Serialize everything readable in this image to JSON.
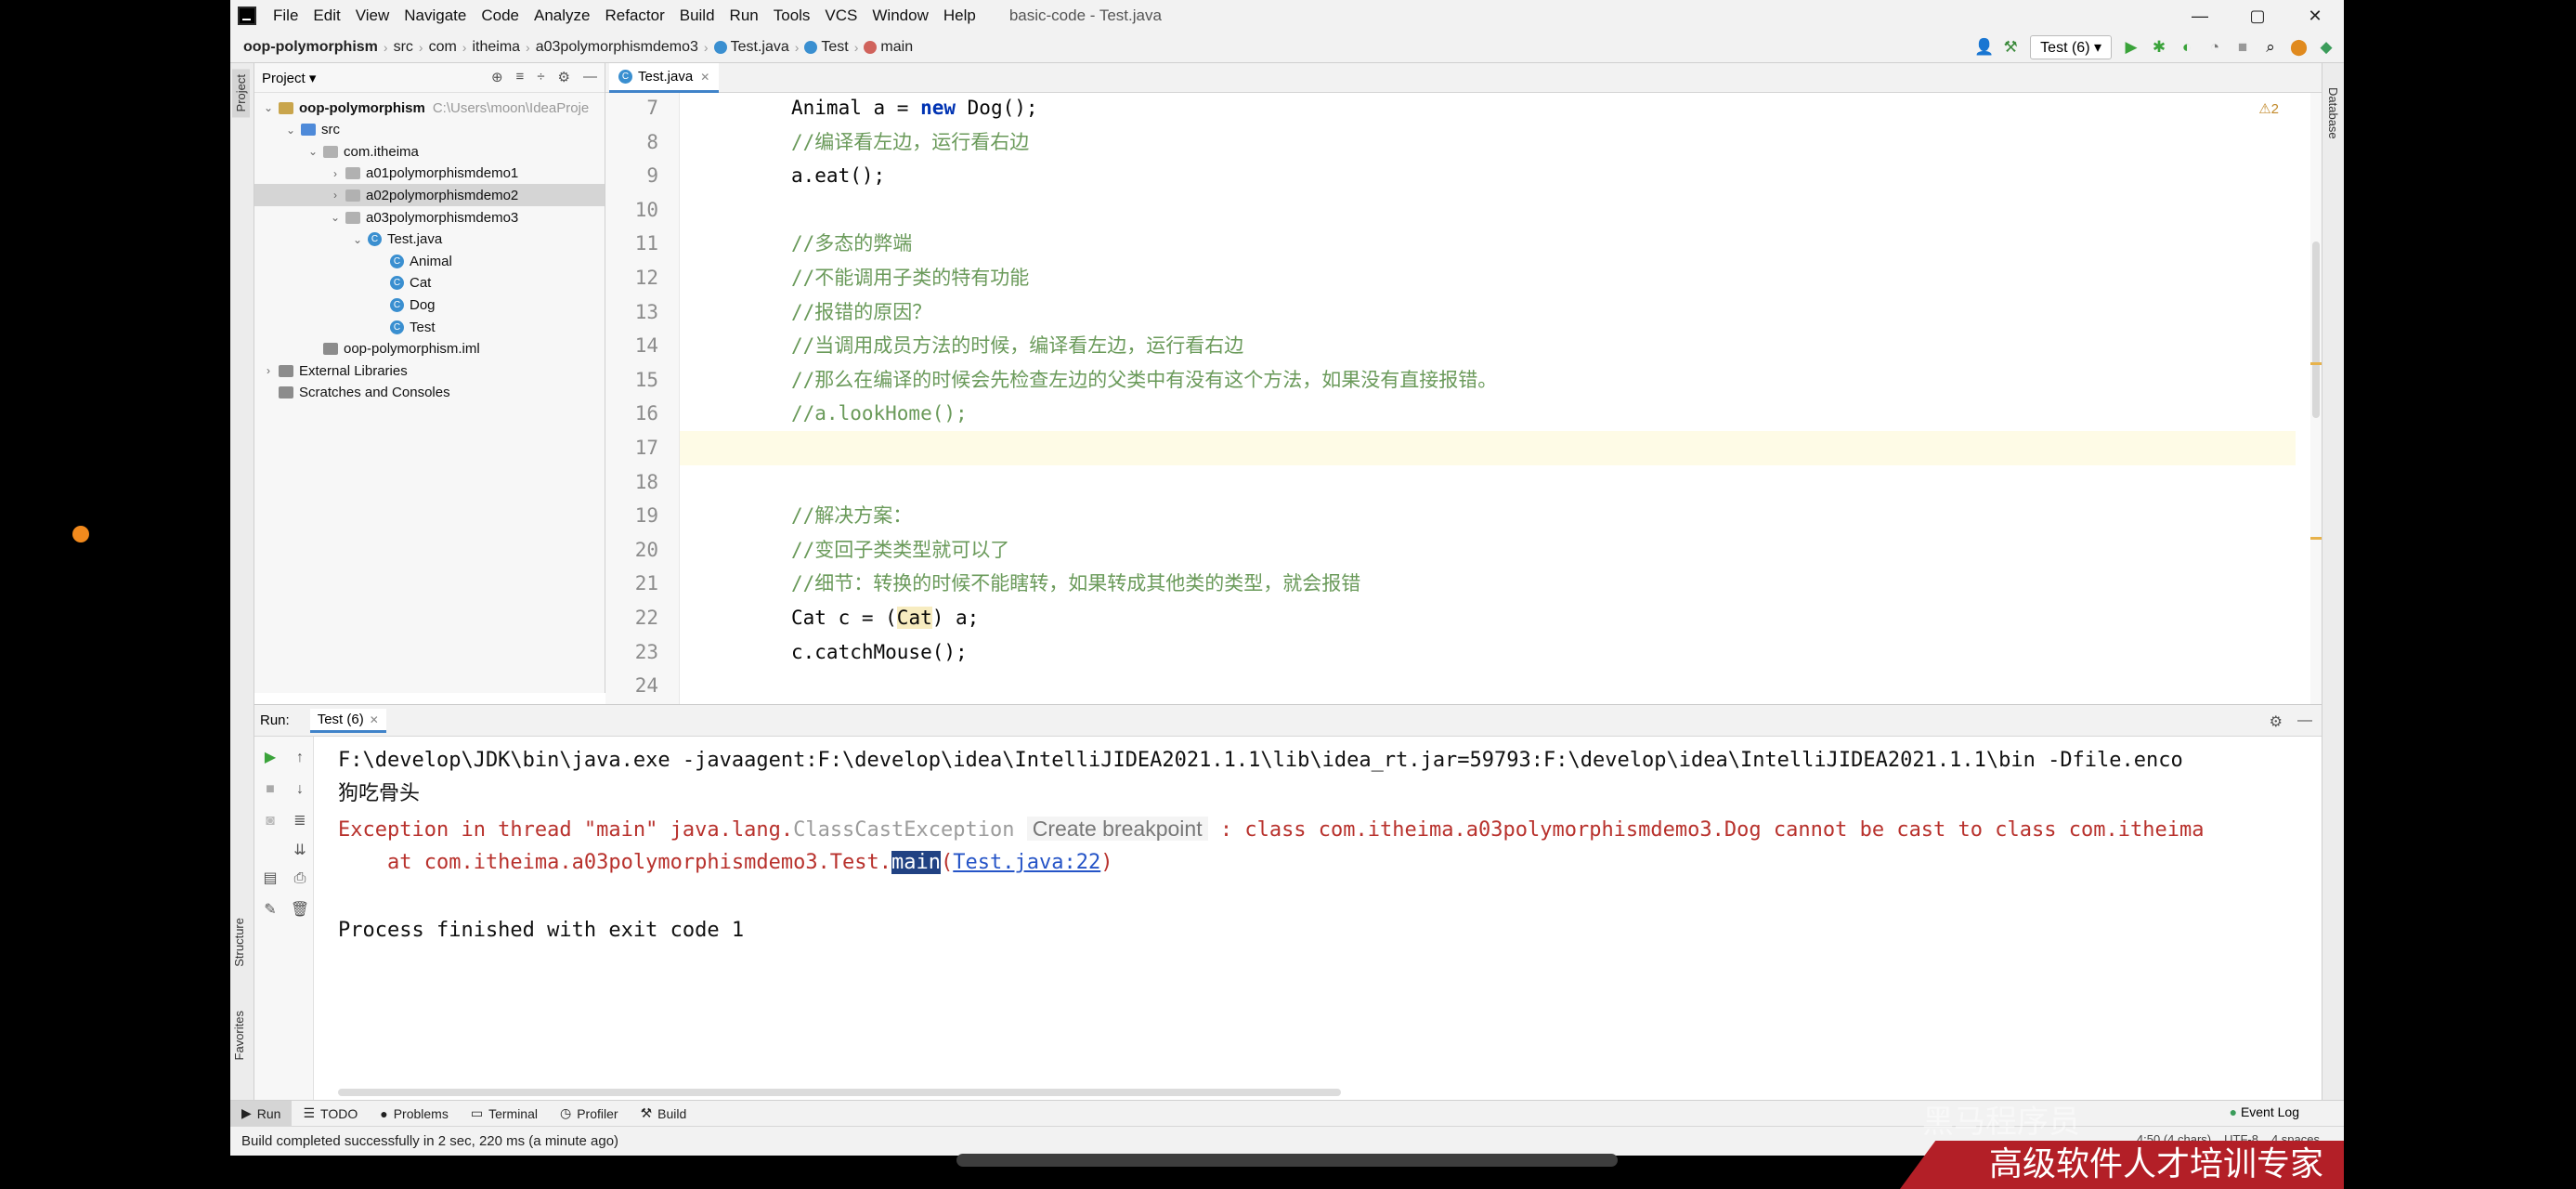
{
  "window": {
    "title": "basic-code - Test.java",
    "menu": [
      "File",
      "Edit",
      "View",
      "Navigate",
      "Code",
      "Analyze",
      "Refactor",
      "Build",
      "Run",
      "Tools",
      "VCS",
      "Window",
      "Help"
    ],
    "controls": [
      "—",
      "▢",
      "✕"
    ]
  },
  "navbar": {
    "crumbs": [
      "oop-polymorphism",
      "src",
      "com",
      "itheima",
      "a03polymorphismdemo3",
      "Test.java",
      "Test",
      "main"
    ],
    "run_config": "Test (6)"
  },
  "side_tabs": {
    "project": "Project",
    "structure": "Structure",
    "favorites": "Favorites",
    "database": "Database"
  },
  "project_panel": {
    "title": "Project",
    "tree": [
      {
        "label": "oop-polymorphism",
        "hint": "C:\\Users\\moon\\IdeaProje",
        "depth": 0,
        "arrow": "open",
        "icon": "folder"
      },
      {
        "label": "src",
        "depth": 1,
        "arrow": "open",
        "icon": "src"
      },
      {
        "label": "com.itheima",
        "depth": 2,
        "arrow": "open",
        "icon": "pkg"
      },
      {
        "label": "a01polymorphismdemo1",
        "depth": 3,
        "arrow": "closed",
        "icon": "pkg"
      },
      {
        "label": "a02polymorphismdemo2",
        "depth": 3,
        "arrow": "closed",
        "icon": "pkg",
        "selected": true
      },
      {
        "label": "a03polymorphismdemo3",
        "depth": 3,
        "arrow": "open",
        "icon": "pkg"
      },
      {
        "label": "Test.java",
        "depth": 4,
        "arrow": "open",
        "icon": "class"
      },
      {
        "label": "Animal",
        "depth": 5,
        "arrow": "",
        "icon": "class"
      },
      {
        "label": "Cat",
        "depth": 5,
        "arrow": "",
        "icon": "class"
      },
      {
        "label": "Dog",
        "depth": 5,
        "arrow": "",
        "icon": "class"
      },
      {
        "label": "Test",
        "depth": 5,
        "arrow": "",
        "icon": "class"
      },
      {
        "label": "oop-polymorphism.iml",
        "depth": 2,
        "arrow": "",
        "icon": "lib"
      },
      {
        "label": "External Libraries",
        "depth": 0,
        "arrow": "closed",
        "icon": "lib"
      },
      {
        "label": "Scratches and Consoles",
        "depth": 0,
        "arrow": "",
        "icon": "lib"
      }
    ]
  },
  "editor": {
    "tab": "Test.java",
    "warning": "⚠2",
    "line_numbers": [
      "7",
      "8",
      "9",
      "10",
      "11",
      "12",
      "13",
      "14",
      "15",
      "16",
      "17",
      "18",
      "19",
      "20",
      "21",
      "22",
      "23",
      "24"
    ],
    "code": [
      "Animal a = new Dog();",
      "//编译看左边，运行看右边",
      "a.eat();",
      "",
      "//多态的弊端",
      "//不能调用子类的特有功能",
      "//报错的原因？",
      "//当调用成员方法的时候，编译看左边，运行看右边",
      "//那么在编译的时候会先检查左边的父类中有没有这个方法，如果没有直接报错。",
      "//a.lookHome();",
      "",
      "",
      "//解决方案：",
      "//变回子类类型就可以了",
      "//细节：转换的时候不能瞎转，如果转成其他类的类型，就会报错",
      "Cat c = (Cat) a;",
      "c.catchMouse();",
      ""
    ]
  },
  "run_panel": {
    "label": "Run:",
    "tab": "Test (6)",
    "console": {
      "cmd": "F:\\develop\\JDK\\bin\\java.exe -javaagent:F:\\develop\\idea\\IntelliJIDEA2021.1.1\\lib\\idea_rt.jar=59793:F:\\develop\\idea\\IntelliJIDEA2021.1.1\\bin -Dfile.enco",
      "output": "狗吃骨头",
      "exc_prefix": "Exception in thread \"main\" java.lang.",
      "exc_class": "ClassCastException",
      "tooltip": "Create breakpoint",
      "exc_suffix": " : class com.itheima.a03polymorphismdemo3.Dog cannot be cast to class com.itheima",
      "at_prefix": "    at com.itheima.a03polymorphismdemo3.Test.",
      "at_method": "main",
      "at_link": "Test.java:22",
      "finished": "Process finished with exit code 1"
    }
  },
  "bottom_tools": [
    "Run",
    "TODO",
    "Problems",
    "Terminal",
    "Profiler",
    "Build"
  ],
  "event_log": "Event Log",
  "status": {
    "message": "Build completed successfully in 2 sec, 220 ms (a minute ago)",
    "position": "4:50 (4 chars)",
    "encoding": "UTF-8",
    "indent": "4 spaces"
  },
  "watermark": "高级软件人才培训专家",
  "watermark_ghost": "黑马程序员"
}
